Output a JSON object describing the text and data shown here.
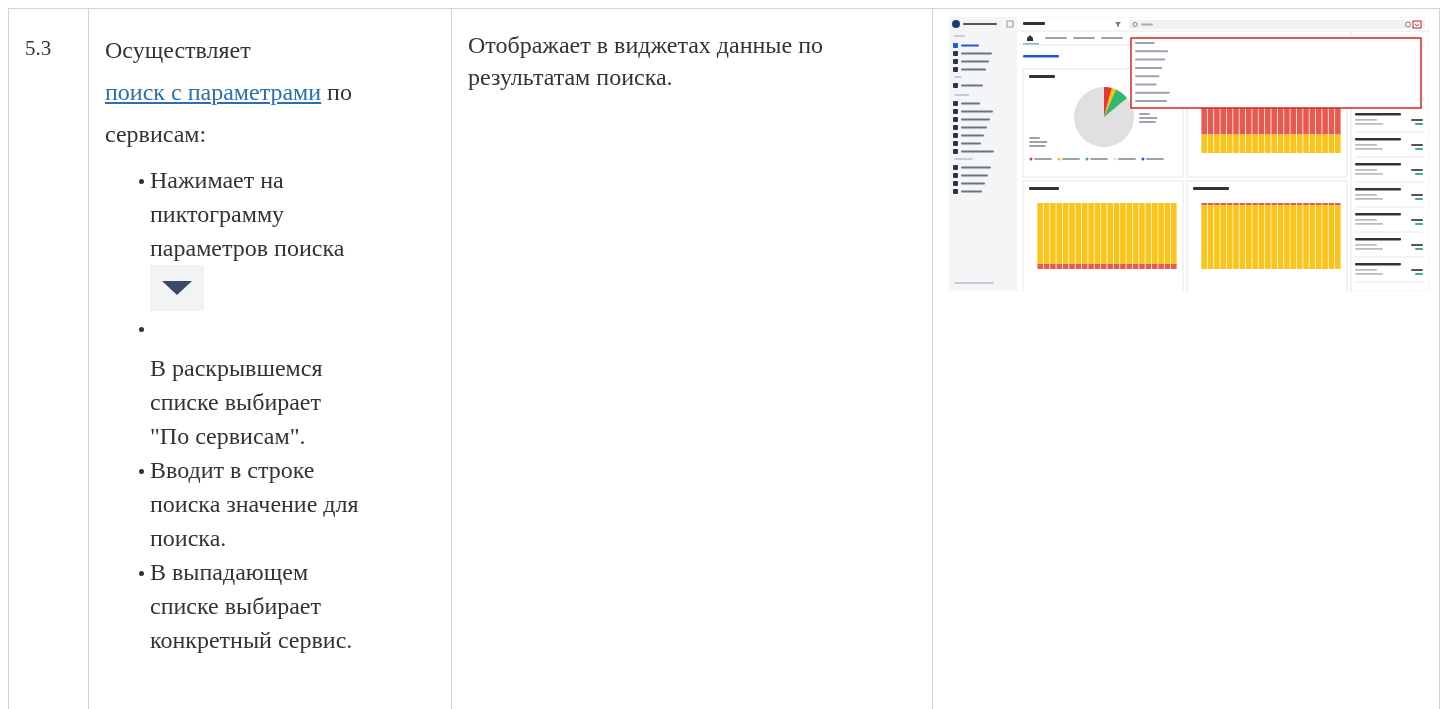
{
  "row": {
    "number": "5.3",
    "intro": {
      "before": "Осуществляет ",
      "link": "поиск с параметрами",
      "after": " по сервисам:"
    },
    "steps": [
      {
        "kind": "icon_after",
        "text": "Нажимает на пиктограмму параметров поиска"
      },
      {
        "kind": "blank_before",
        "text": "В раскрывшемся списке выбирает \"По сервисам\"."
      },
      {
        "kind": "plain",
        "text": "Вводит в строке поиска значение для поиска."
      },
      {
        "kind": "plain",
        "text": "В выпадающем списке выбирает конкретный сервис."
      }
    ],
    "result": "Отображает в виджетах данные по результатам поиска."
  }
}
